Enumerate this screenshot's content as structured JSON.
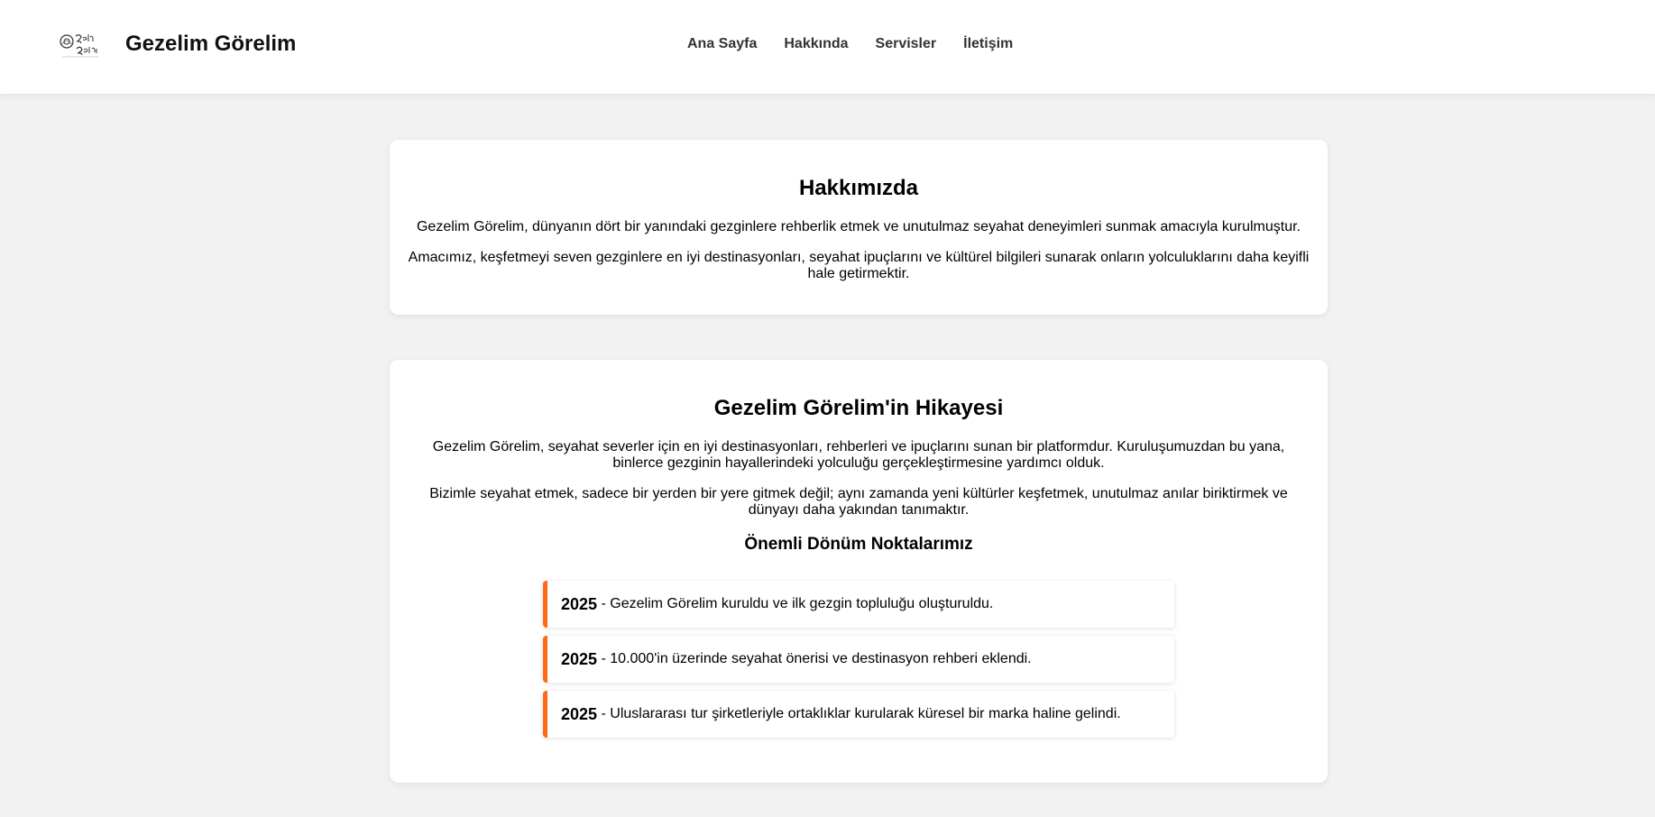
{
  "header": {
    "brand": "Gezelim Görelim",
    "logo_icon": "gezelim-gorelim-logo",
    "nav": [
      {
        "label": "Ana Sayfa"
      },
      {
        "label": "Hakkında"
      },
      {
        "label": "Servisler"
      },
      {
        "label": "İletişim"
      }
    ]
  },
  "about": {
    "title": "Hakkımızda",
    "paragraphs": [
      "Gezelim Görelim, dünyanın dört bir yanındaki gezginlere rehberlik etmek ve unutulmaz seyahat deneyimleri sunmak amacıyla kurulmuştur.",
      "Amacımız, keşfetmeyi seven gezginlere en iyi destinasyonları, seyahat ipuçlarını ve kültürel bilgileri sunarak onların yolculuklarını daha keyifli hale getirmektir."
    ]
  },
  "story": {
    "title": "Gezelim Görelim'in Hikayesi",
    "paragraphs": [
      "Gezelim Görelim, seyahat severler için en iyi destinasyonları, rehberleri ve ipuçlarını sunan bir platformdur. Kuruluşumuzdan bu yana, binlerce gezginin hayallerindeki yolculuğu gerçekleştirmesine yardımcı olduk.",
      "Bizimle seyahat etmek, sadece bir yerden bir yere gitmek değil; aynı zamanda yeni kültürler keşfetmek, unutulmaz anılar biriktirmek ve dünyayı daha yakından tanımaktır."
    ],
    "milestones_title": "Önemli Dönüm Noktalarımız",
    "milestones": [
      {
        "year": "2025",
        "text": " - Gezelim Görelim kuruldu ve ilk gezgin topluluğu oluşturuldu."
      },
      {
        "year": "2025",
        "text": " - 10.000'in üzerinde seyahat önerisi ve destinasyon rehberi eklendi."
      },
      {
        "year": "2025",
        "text": " - Uluslararası tur şirketleriyle ortaklıklar kurularak küresel bir marka haline gelindi."
      }
    ]
  },
  "colors": {
    "accent": "#ff6a13",
    "page_background": "#f2f2f2",
    "card_background": "#ffffff"
  }
}
